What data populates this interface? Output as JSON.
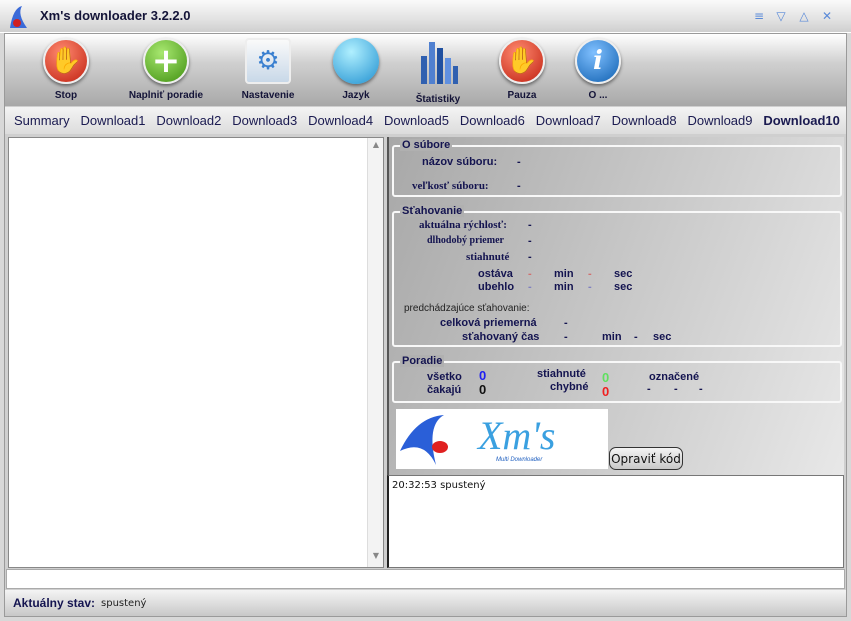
{
  "window": {
    "title": "Xm's downloader 3.2.2.0"
  },
  "toolbar": [
    {
      "label": "Stop",
      "icon": "stop-hand-icon",
      "color": "#d03020"
    },
    {
      "label": "Naplniť poradie",
      "icon": "plus-icon",
      "color": "#58b020"
    },
    {
      "label": "Nastavenie",
      "icon": "settings-gear-icon",
      "color": "#7aa8d8"
    },
    {
      "label": "Jazyk",
      "icon": "speech-bubble-icon",
      "color": "#40b0e0"
    },
    {
      "label": "Štatistiky",
      "icon": "bar-chart-icon",
      "color": "#3060b0"
    },
    {
      "label": "Pauza",
      "icon": "pause-hand-icon",
      "color": "#d03020"
    },
    {
      "label": "O ...",
      "icon": "info-icon",
      "color": "#2070c0"
    }
  ],
  "tabs": [
    "Summary",
    "Download1",
    "Download2",
    "Download3",
    "Download4",
    "Download5",
    "Download6",
    "Download7",
    "Download8",
    "Download9",
    "Download10"
  ],
  "active_tab": "Download10",
  "file": {
    "title": "O súbore",
    "name_label": "názov súboru:",
    "name_value": "-",
    "size_label": "veľkosť súboru:",
    "size_value": "-"
  },
  "download": {
    "title": "Sťahovanie",
    "speed_label": "aktuálna rýchlosť:",
    "speed_value": "-",
    "avg_label": "dlhodobý priemer",
    "avg_value": "-",
    "downloaded_label": "stiahnuté",
    "downloaded_value": "-",
    "remaining_label": "ostáva",
    "remaining_min": "-",
    "remaining_sec": "-",
    "elapsed_label": "ubehlo",
    "elapsed_min": "-",
    "elapsed_sec": "-",
    "min_label": "min",
    "sec_label": "sec",
    "previous_label": "predchádzajúce sťahovanie:",
    "total_avg_label": "celková priemerná",
    "total_avg_value": "-",
    "dl_time_label": "sťahovaný čas",
    "dl_time_min": "-",
    "dl_time_sec": "-"
  },
  "queue": {
    "title": "Poradie",
    "all_label": "všetko",
    "all_value": "0",
    "waiting_label": "čakajú",
    "waiting_value": "0",
    "done_label": "stiahnuté",
    "done_value": "0",
    "failed_label": "chybné",
    "failed_value": "0",
    "marked_label": "označené",
    "marked_values": [
      "-",
      "-",
      "-"
    ]
  },
  "logo": {
    "text": "Xm's",
    "subtitle": "Multi Downloader"
  },
  "fix_button": "Opraviť kód",
  "log": [
    "20:32:53  spustený"
  ],
  "status": {
    "label": "Aktuálny stav:",
    "value": "spustený"
  }
}
